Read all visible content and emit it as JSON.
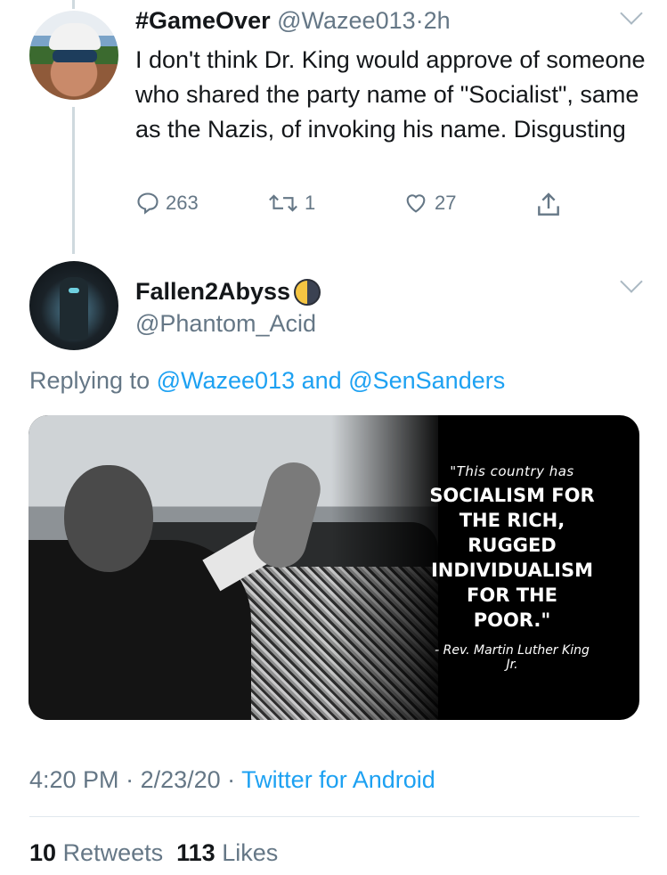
{
  "tweet1": {
    "display_name": "#GameOver",
    "handle": "@Wazee013",
    "separator": "·",
    "time": "2h",
    "text": "I don't think Dr. King would approve of someone who shared the party name of \"Socialist\", same as the Nazis, of invoking his name.  Disgusting",
    "replies": "263",
    "retweets": "1",
    "likes": "27"
  },
  "tweet2": {
    "display_name": "Fallen2Abyss",
    "handle": "@Phantom_Acid",
    "replying_prefix": "Replying to",
    "reply_to_1": "@Wazee013",
    "reply_to_and": "and",
    "reply_to_2": "@SenSanders",
    "media": {
      "quote_intro": "\"This country has",
      "quote_main": "SOCIALISM FOR THE RICH, RUGGED INDIVIDUALISM FOR THE POOR.\"",
      "attribution": "- Rev. Martin Luther King Jr."
    },
    "time": "4:20 PM",
    "date": "2/23/20",
    "source": "Twitter for Android",
    "retweets_count": "10",
    "retweets_label": "Retweets",
    "likes_count": "113",
    "likes_label": "Likes"
  },
  "icons": [
    "reply-icon",
    "retweet-icon",
    "like-icon",
    "share-icon",
    "chevron-down-icon",
    "moon-emoji-icon"
  ],
  "colors": {
    "link": "#1da1f2",
    "muted": "#657786",
    "text": "#14171a"
  }
}
